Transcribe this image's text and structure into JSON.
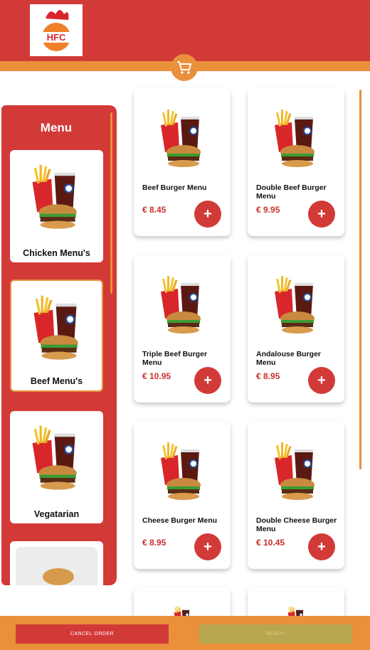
{
  "app": {
    "logo_text": "HFC"
  },
  "colors": {
    "brand_red": "#d23a38",
    "accent_orange": "#ea8f3a",
    "ready_disabled": "#b8a64f"
  },
  "header": {
    "cart_icon": "shopping-cart-icon"
  },
  "sidebar": {
    "title": "Menu",
    "categories": [
      {
        "label": "Chicken Menu's",
        "active": false
      },
      {
        "label": "Beef Menu's",
        "active": true
      },
      {
        "label": "Vegatarian",
        "active": false
      },
      {
        "label": "",
        "active": false
      }
    ]
  },
  "products": [
    {
      "name": "Beef Burger Menu",
      "price": "€ 8.45",
      "add_label": "+"
    },
    {
      "name": "Double Beef Burger Menu",
      "price": "€ 9.95",
      "add_label": "+"
    },
    {
      "name": "Triple Beef Burger Menu",
      "price": "€ 10.95",
      "add_label": "+"
    },
    {
      "name": "Andalouse Burger Menu",
      "price": "€ 8.95",
      "add_label": "+"
    },
    {
      "name": "Cheese Burger Menu",
      "price": "€ 8.95",
      "add_label": "+"
    },
    {
      "name": "Double Cheese Burger Menu",
      "price": "€ 10.45",
      "add_label": "+"
    }
  ],
  "footer": {
    "cancel_label": "CANCEL ORDER",
    "ready_label": "READY"
  }
}
